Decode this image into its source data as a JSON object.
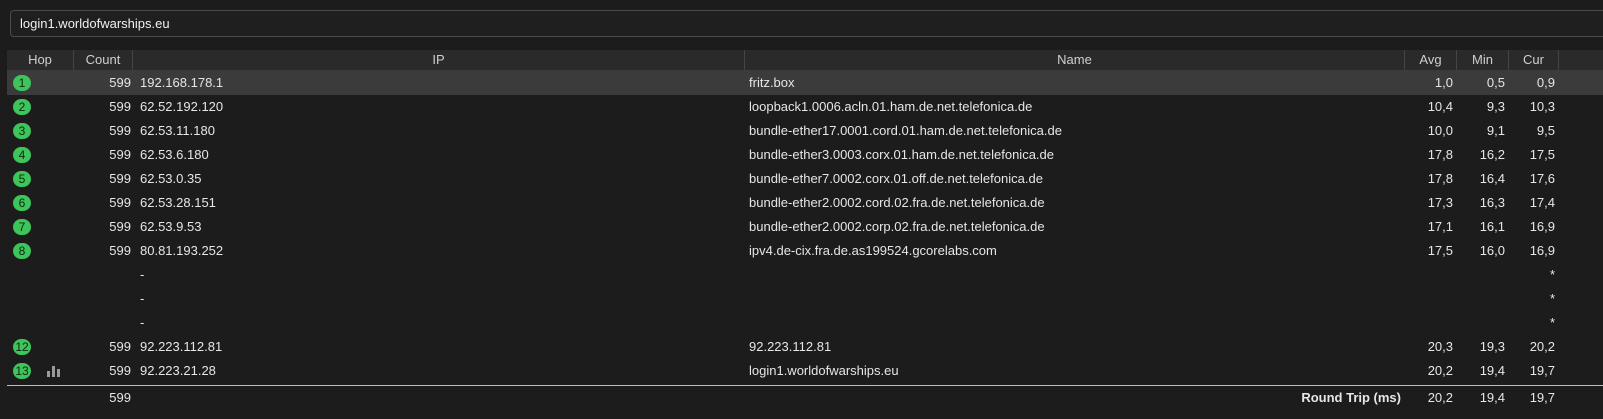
{
  "address": {
    "value": "login1.worldofwarships.eu"
  },
  "columns": {
    "hop": "Hop",
    "count": "Count",
    "ip": "IP",
    "name": "Name",
    "avg": "Avg",
    "min": "Min",
    "cur": "Cur"
  },
  "rows": [
    {
      "hop": "1",
      "count": "599",
      "ip": "192.168.178.1",
      "name": "fritz.box",
      "avg": "1,0",
      "min": "0,5",
      "cur": "0,9"
    },
    {
      "hop": "2",
      "count": "599",
      "ip": "62.52.192.120",
      "name": "loopback1.0006.acln.01.ham.de.net.telefonica.de",
      "avg": "10,4",
      "min": "9,3",
      "cur": "10,3"
    },
    {
      "hop": "3",
      "count": "599",
      "ip": "62.53.11.180",
      "name": "bundle-ether17.0001.cord.01.ham.de.net.telefonica.de",
      "avg": "10,0",
      "min": "9,1",
      "cur": "9,5"
    },
    {
      "hop": "4",
      "count": "599",
      "ip": "62.53.6.180",
      "name": "bundle-ether3.0003.corx.01.ham.de.net.telefonica.de",
      "avg": "17,8",
      "min": "16,2",
      "cur": "17,5"
    },
    {
      "hop": "5",
      "count": "599",
      "ip": "62.53.0.35",
      "name": "bundle-ether7.0002.corx.01.off.de.net.telefonica.de",
      "avg": "17,8",
      "min": "16,4",
      "cur": "17,6"
    },
    {
      "hop": "6",
      "count": "599",
      "ip": "62.53.28.151",
      "name": "bundle-ether2.0002.cord.02.fra.de.net.telefonica.de",
      "avg": "17,3",
      "min": "16,3",
      "cur": "17,4"
    },
    {
      "hop": "7",
      "count": "599",
      "ip": "62.53.9.53",
      "name": "bundle-ether2.0002.corp.02.fra.de.net.telefonica.de",
      "avg": "17,1",
      "min": "16,1",
      "cur": "16,9"
    },
    {
      "hop": "8",
      "count": "599",
      "ip": "80.81.193.252",
      "name": "ipv4.de-cix.fra.de.as199524.gcorelabs.com",
      "avg": "17,5",
      "min": "16,0",
      "cur": "16,9"
    },
    {
      "hop": "",
      "count": "",
      "ip": "-",
      "name": "",
      "avg": "",
      "min": "",
      "cur": "*"
    },
    {
      "hop": "",
      "count": "",
      "ip": "-",
      "name": "",
      "avg": "",
      "min": "",
      "cur": "*"
    },
    {
      "hop": "",
      "count": "",
      "ip": "-",
      "name": "",
      "avg": "",
      "min": "",
      "cur": "*"
    },
    {
      "hop": "12",
      "count": "599",
      "ip": "92.223.112.81",
      "name": "92.223.112.81",
      "avg": "20,3",
      "min": "19,3",
      "cur": "20,2"
    },
    {
      "hop": "13",
      "count": "599",
      "ip": "92.223.21.28",
      "name": "login1.worldofwarships.eu",
      "avg": "20,2",
      "min": "19,4",
      "cur": "19,7",
      "icon": "bar-chart-icon"
    }
  ],
  "total": {
    "count": "599",
    "label": "Round Trip (ms)",
    "avg": "20,2",
    "min": "19,4",
    "cur": "19,7"
  },
  "colors": {
    "badge": "#3dc45a",
    "selected_row": "#3b3b3b",
    "background": "#1c1c1c"
  }
}
